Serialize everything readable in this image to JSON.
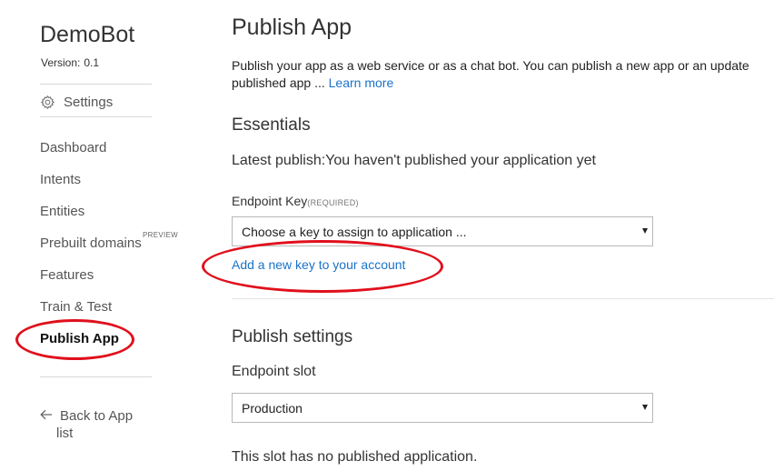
{
  "sidebar": {
    "app_name": "DemoBot",
    "version_label": "Version:",
    "version_value": "0.1",
    "settings_label": "Settings",
    "settings_icon": "gear-icon",
    "items": [
      {
        "label": "Dashboard"
      },
      {
        "label": "Intents"
      },
      {
        "label": "Entities"
      },
      {
        "label": "Prebuilt domains",
        "tag": "PREVIEW"
      },
      {
        "label": "Features"
      },
      {
        "label": "Train & Test"
      },
      {
        "label": "Publish App",
        "active": true
      }
    ],
    "back_link_line1": "Back to App",
    "back_link_line2": "list",
    "back_icon": "arrow-left-icon"
  },
  "main": {
    "title": "Publish App",
    "intro_line1": "Publish your app as a web service or as a chat bot. You can publish a new app or an update",
    "intro_line2": "published app ...",
    "learn_more": "Learn more",
    "essentials": {
      "heading": "Essentials",
      "latest_publish": "Latest publish:You haven't published your application yet",
      "endpoint_key_label": "Endpoint Key",
      "endpoint_key_required": "(REQUIRED)",
      "endpoint_key_value": "Choose a key to assign to application ...",
      "add_key_link": "Add a new key to your account"
    },
    "publish_settings": {
      "heading": "Publish settings",
      "slot_label": "Endpoint slot",
      "slot_value": "Production",
      "slot_status": "This slot has no published application."
    }
  },
  "colors": {
    "accent_link": "#1a73c8",
    "annotation_red": "#e0101c"
  }
}
